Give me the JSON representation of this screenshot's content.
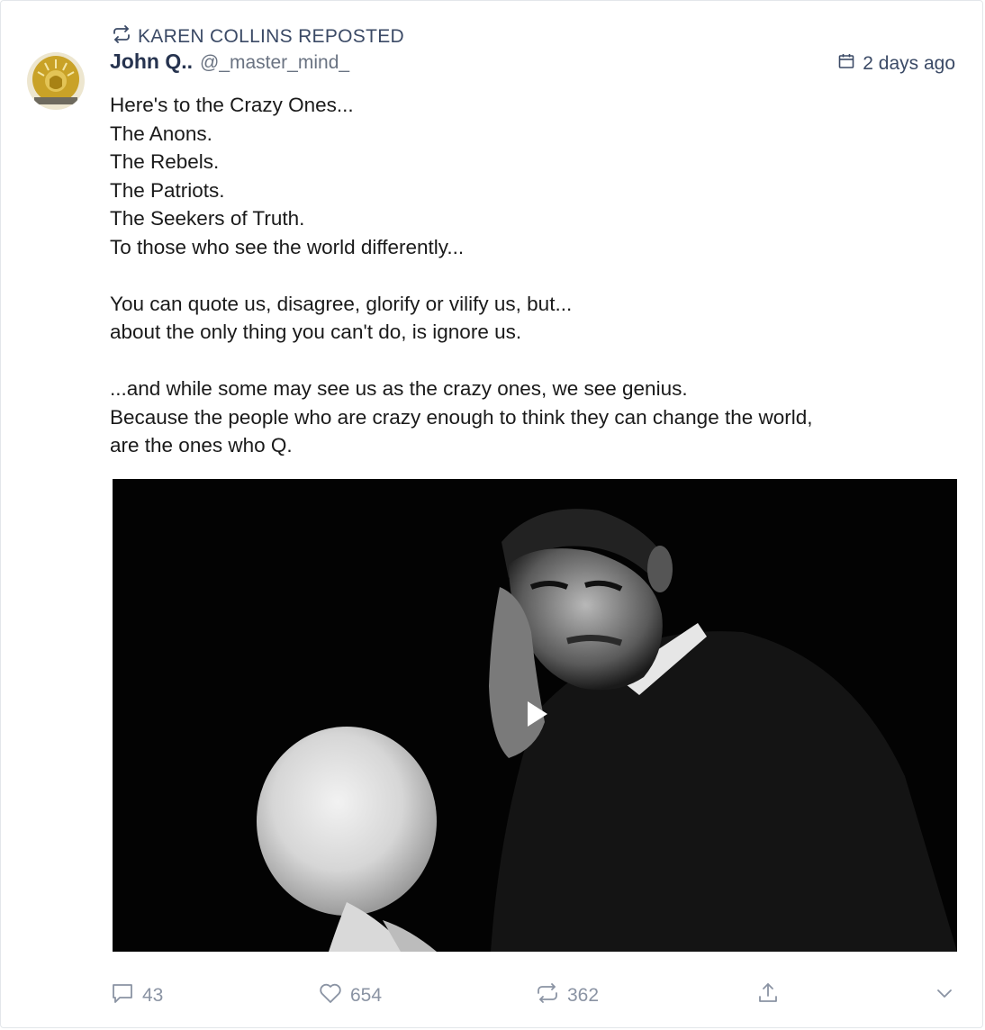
{
  "post": {
    "repost_label": "KAREN COLLINS REPOSTED",
    "author": {
      "name": "John Q..",
      "handle": "@_master_mind_"
    },
    "timestamp": "2 days ago",
    "body": "Here's to the Crazy Ones...\nThe Anons.\nThe Rebels.\nThe Patriots.\nThe Seekers of Truth.\nTo those who see the world differently...\n\nYou can quote us, disagree, glorify or vilify us, but...\nabout the only thing you can't do, is ignore us.\n\n...and while some may see us as the crazy ones, we see genius.\nBecause the people who are crazy enough to think they can change the world,\nare the ones who Q.",
    "media": {
      "type": "video",
      "icon": "play-icon"
    },
    "actions": {
      "comments": "43",
      "likes": "654",
      "reposts": "362"
    }
  },
  "colors": {
    "accent": "#3b4a66",
    "muted": "#8a93a3",
    "author": "#26334f"
  }
}
